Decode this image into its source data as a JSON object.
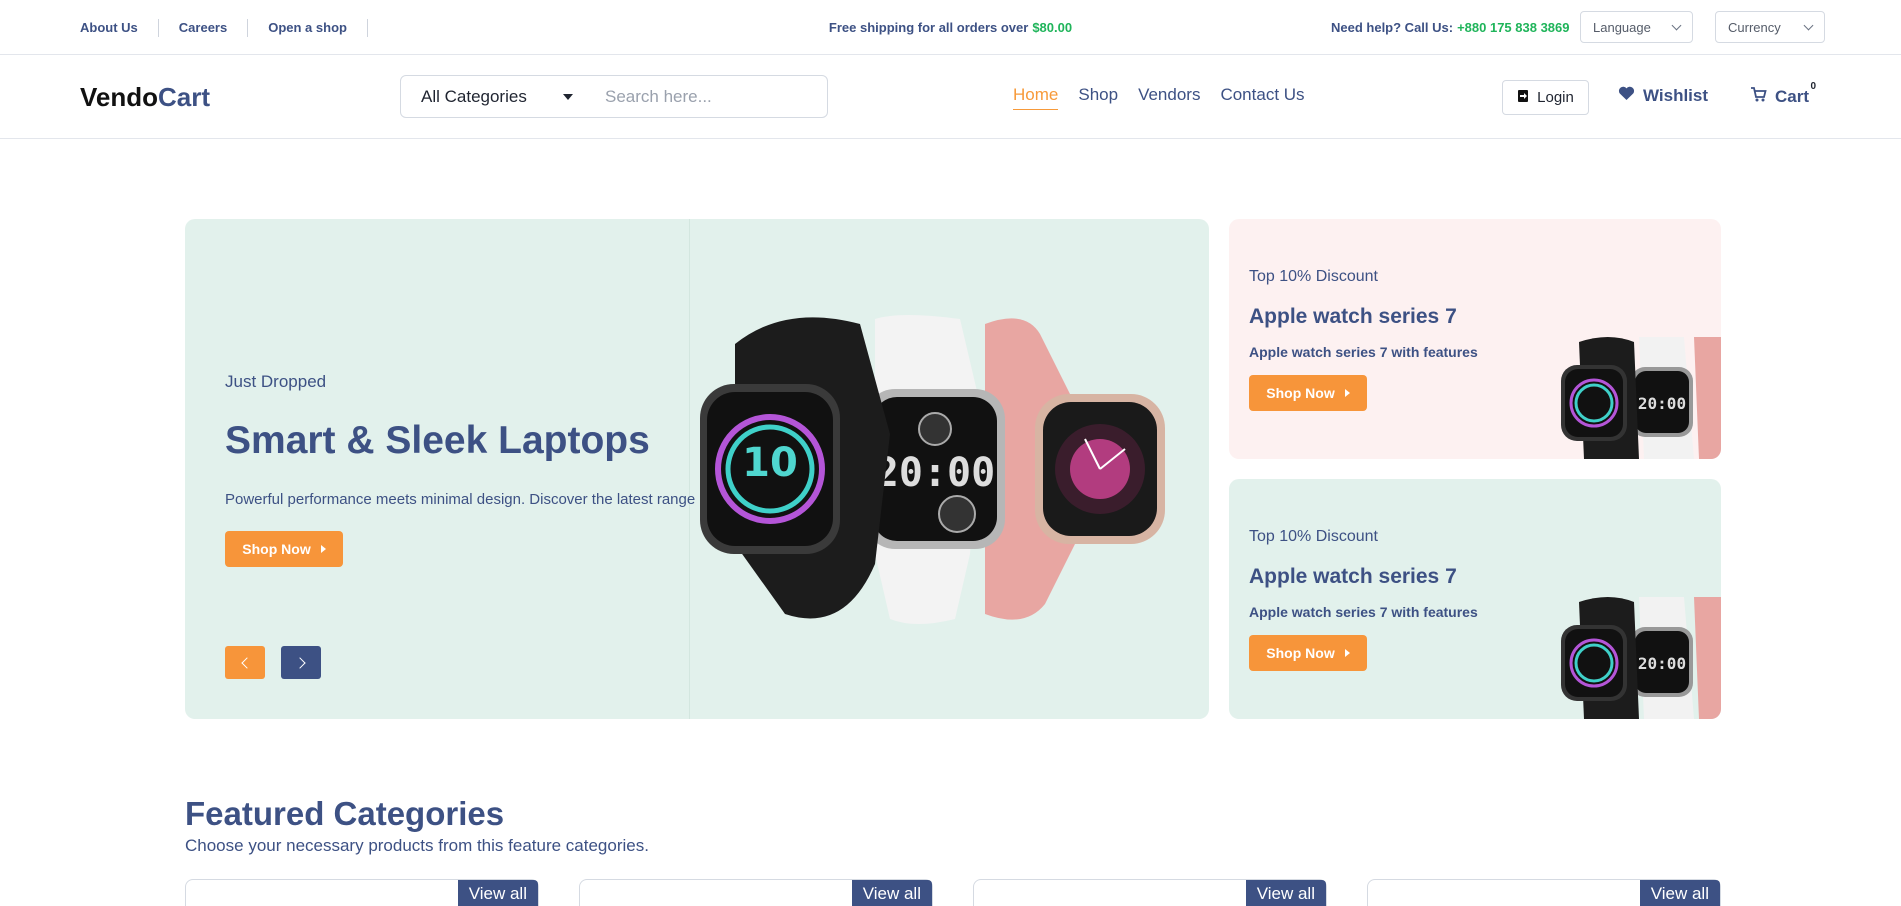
{
  "topbar": {
    "links": [
      "About Us",
      "Careers",
      "Open a shop"
    ],
    "shipping_text": "Free shipping for all orders over",
    "shipping_amount": "$80.00",
    "help_text": "Need help? Call Us:",
    "help_phone": "+880 175 838 3869",
    "language_label": "Language",
    "currency_label": "Currency"
  },
  "header": {
    "logo_part1": "Vendo",
    "logo_part2": "Cart",
    "category_select": "All Categories",
    "search_placeholder": "Search here...",
    "nav": [
      "Home",
      "Shop",
      "Vendors",
      "Contact Us"
    ],
    "active_nav": "Home",
    "login_label": "Login",
    "wishlist_label": "Wishlist",
    "cart_label": "Cart",
    "cart_count": "0"
  },
  "hero": {
    "eyebrow": "Just Dropped",
    "title": "Smart & Sleek Laptops",
    "description": "Powerful performance meets minimal design. Discover the latest range of smart laptops built for work and play.",
    "button_label": "Shop Now",
    "prev_icon": "chevron-left-icon",
    "next_icon": "chevron-right-icon"
  },
  "promos": [
    {
      "eyebrow": "Top 10% Discount",
      "title": "Apple watch series 7",
      "description": "Apple watch series 7 with features",
      "button_label": "Shop Now",
      "background": "#fdf1f1"
    },
    {
      "eyebrow": "Top 10% Discount",
      "title": "Apple watch series 7",
      "description": "Apple watch series 7 with features",
      "button_label": "Shop Now",
      "background": "#e2f1ec"
    }
  ],
  "featured": {
    "title": "Featured Categories",
    "subtitle": "Choose your necessary products from this feature categories.",
    "cards": [
      {
        "view_all": "View all"
      },
      {
        "view_all": "View all"
      },
      {
        "view_all": "View all"
      },
      {
        "view_all": "View all"
      }
    ]
  },
  "colors": {
    "primary": "#3d5184",
    "accent": "#f7953a",
    "green": "#1fb45a",
    "mint": "#e2f1ec",
    "blush": "#fdf1f1"
  }
}
